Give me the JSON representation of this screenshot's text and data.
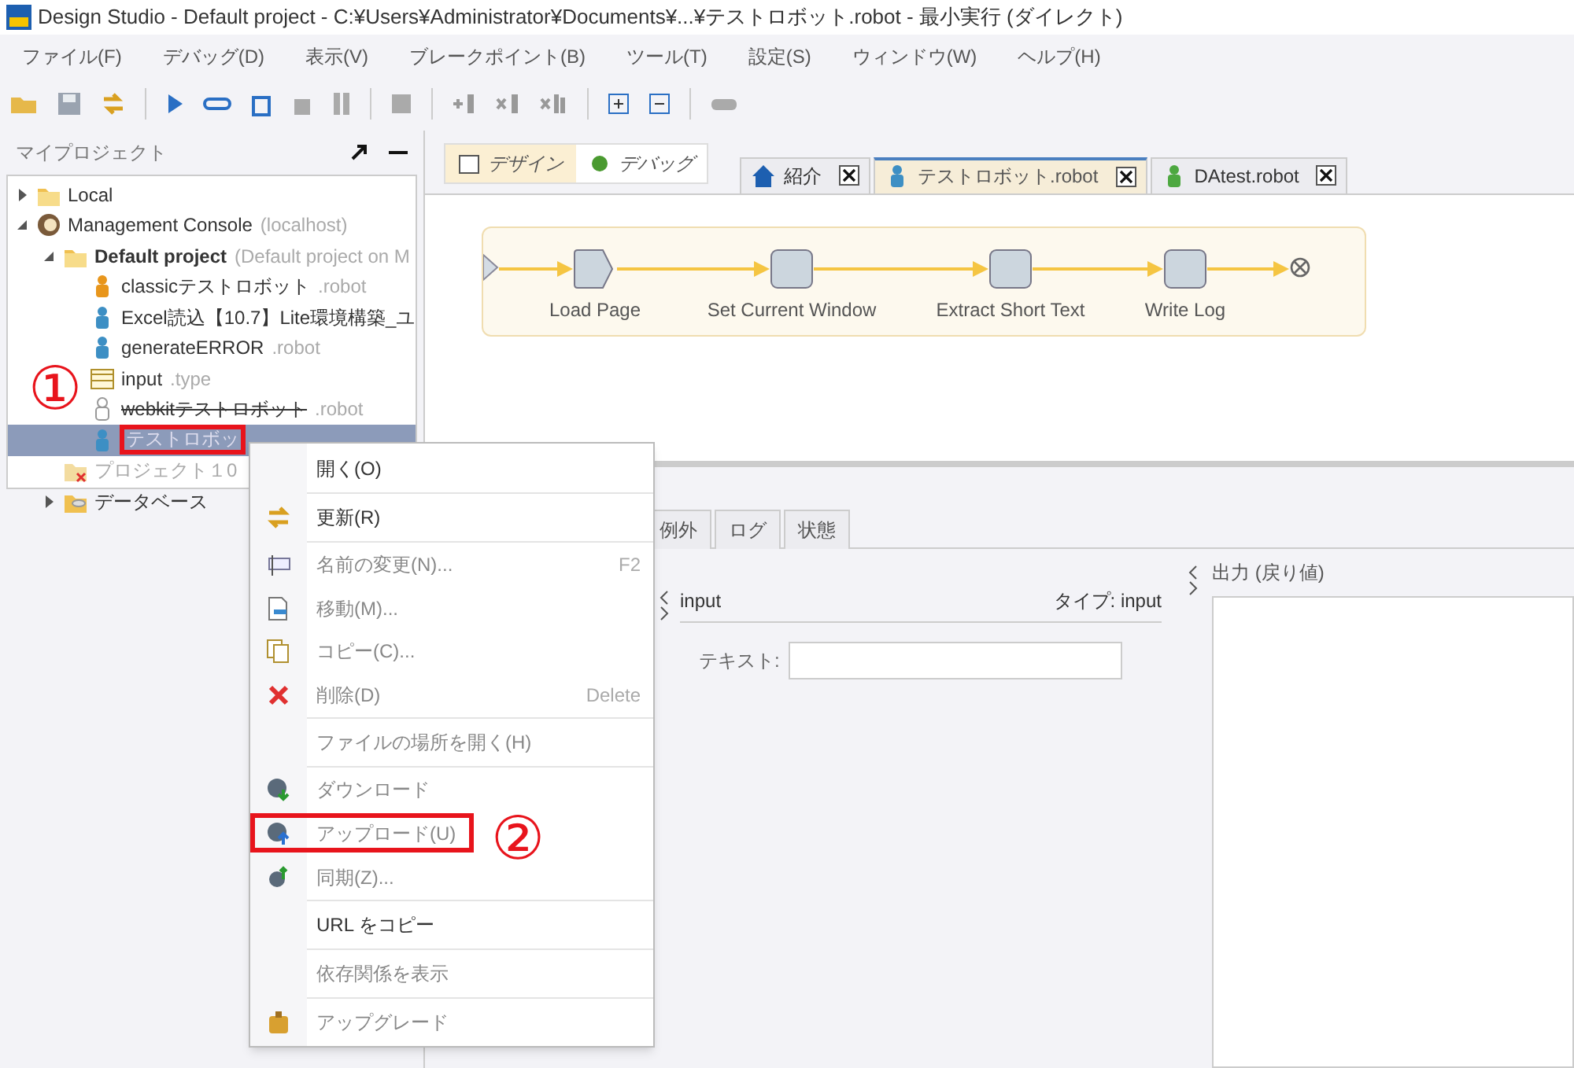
{
  "window": {
    "title": "Design Studio - Default project - C:¥Users¥Administrator¥Documents¥...¥テストロボット.robot - 最小実行 (ダイレクト)"
  },
  "menu_bar": [
    "ファイル(F)",
    "デバッグ(D)",
    "表示(V)",
    "ブレークポイント(B)",
    "ツール(T)",
    "設定(S)",
    "ウィンドウ(W)",
    "ヘルプ(H)"
  ],
  "project_panel": {
    "title": "マイプロジェクト",
    "tree": [
      {
        "label": "Local",
        "kind": "folder",
        "expanded": false,
        "selected": false,
        "annotated": false
      },
      {
        "label": "Management Console",
        "suffix": "(localhost)",
        "kind": "server",
        "expanded": true,
        "selected": false,
        "annotated": false,
        "children": [
          {
            "label": "Default project",
            "suffix": "(Default project on M",
            "kind": "folder",
            "bold": true,
            "expanded": true,
            "selected": false,
            "annotated": false,
            "children": [
              {
                "label": "classicテストロボット",
                "suffix": ".robot",
                "kind": "classic-robot",
                "selected": false,
                "annotated": false
              },
              {
                "label": "Excel読込【10.7】Lite環境構築_ユ",
                "kind": "robot",
                "selected": false,
                "annotated": false
              },
              {
                "label": "generateERROR",
                "suffix": ".robot",
                "kind": "robot",
                "selected": false,
                "annotated": false
              },
              {
                "label": "input",
                "suffix": ".type",
                "kind": "type",
                "selected": false,
                "annotated": false
              },
              {
                "label": "webkitテストロボット",
                "suffix": ".robot",
                "kind": "broken-robot",
                "struck": true,
                "selected": false,
                "annotated": false
              },
              {
                "label": "テストロボッ",
                "kind": "robot",
                "selected": true,
                "annotated": true
              }
            ]
          },
          {
            "label": "プロジェクト１0",
            "kind": "broken-project",
            "disabled": true,
            "selected": false,
            "annotated": false
          },
          {
            "label": "データベース",
            "kind": "database",
            "expanded": false,
            "selected": false,
            "annotated": false
          }
        ]
      }
    ]
  },
  "mode_buttons": [
    {
      "label": "デザイン",
      "selected": true
    },
    {
      "label": "デバッグ",
      "selected": false
    }
  ],
  "editor_tabs": [
    {
      "label": "紹介",
      "kind": "home",
      "selected": false
    },
    {
      "label": "テストロボット.robot",
      "kind": "robot",
      "selected": true
    },
    {
      "label": "DAtest.robot",
      "kind": "green-robot",
      "selected": false
    }
  ],
  "flow": {
    "steps": [
      {
        "label": "Load Page",
        "kind": "page"
      },
      {
        "label": "Set Current Window",
        "kind": "action"
      },
      {
        "label": "Extract Short Text",
        "kind": "action"
      },
      {
        "label": "Write Log",
        "kind": "action"
      }
    ]
  },
  "bottom_tabs": [
    {
      "label": "例外",
      "selected": false
    },
    {
      "label": "ログ",
      "selected": false
    },
    {
      "label": "状態",
      "selected": false
    }
  ],
  "input_panel": {
    "name": "input",
    "type": "タイプ: input",
    "field_label": "テキスト:"
  },
  "output_panel": {
    "title": "出力 (戻り値)"
  },
  "context_menu": [
    [
      {
        "label": "開く(O)",
        "disabled": false,
        "annotated": false
      }
    ],
    [
      {
        "label": "更新(R)",
        "kind": "refresh",
        "disabled": false,
        "annotated": false
      }
    ],
    [
      {
        "label": "名前の変更(N)...",
        "kind": "rename",
        "shortcut": "F2",
        "disabled": true,
        "annotated": false
      },
      {
        "label": "移動(M)...",
        "kind": "move",
        "disabled": true,
        "annotated": false
      },
      {
        "label": "コピー(C)...",
        "kind": "copy",
        "disabled": true,
        "annotated": false
      },
      {
        "label": "削除(D)",
        "kind": "delete",
        "shortcut": "Delete",
        "disabled": true,
        "annotated": false
      }
    ],
    [
      {
        "label": "ファイルの場所を開く(H)",
        "disabled": true,
        "annotated": false
      }
    ],
    [
      {
        "label": "ダウンロード",
        "kind": "download",
        "disabled": true,
        "annotated": false
      },
      {
        "label": "アップロード(U)",
        "kind": "upload",
        "disabled": true,
        "annotated": true
      },
      {
        "label": "同期(Z)...",
        "kind": "sync",
        "disabled": true,
        "annotated": false
      }
    ],
    [
      {
        "label": "URL をコピー",
        "disabled": false,
        "annotated": false
      }
    ],
    [
      {
        "label": "依存関係を表示",
        "disabled": true,
        "annotated": false
      }
    ],
    [
      {
        "label": "アップグレード",
        "kind": "upgrade",
        "disabled": true,
        "annotated": false
      }
    ]
  ],
  "annotations": [
    {
      "text": "①"
    },
    {
      "text": "②"
    }
  ]
}
